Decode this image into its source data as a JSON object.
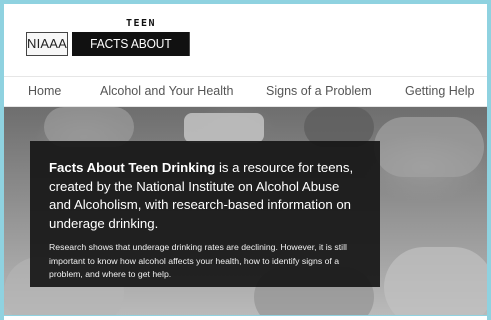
{
  "header": {
    "logo_org": "NIAAA",
    "logo_main": "FACTS ABOUT DRINKING",
    "logo_teen": "TEEN"
  },
  "nav": {
    "items": [
      {
        "label": "Home"
      },
      {
        "label": "Alcohol and Your Health"
      },
      {
        "label": "Signs of a Problem"
      },
      {
        "label": "Getting Help"
      }
    ]
  },
  "hero": {
    "lead_bold": "Facts About Teen Drinking",
    "lead_rest": " is a resource for teens, created by the National Institute on Alcohol Abuse and Alcoholism, with research-based information on underage drinking.",
    "body": "Research shows that underage drinking rates are declining. However, it is still important to know how alcohol affects your health, how to identify signs of a problem, and where to get help."
  },
  "colors": {
    "frame_border": "#8fd2e0",
    "overlay_bg": "#161616",
    "nav_text": "#555555"
  }
}
